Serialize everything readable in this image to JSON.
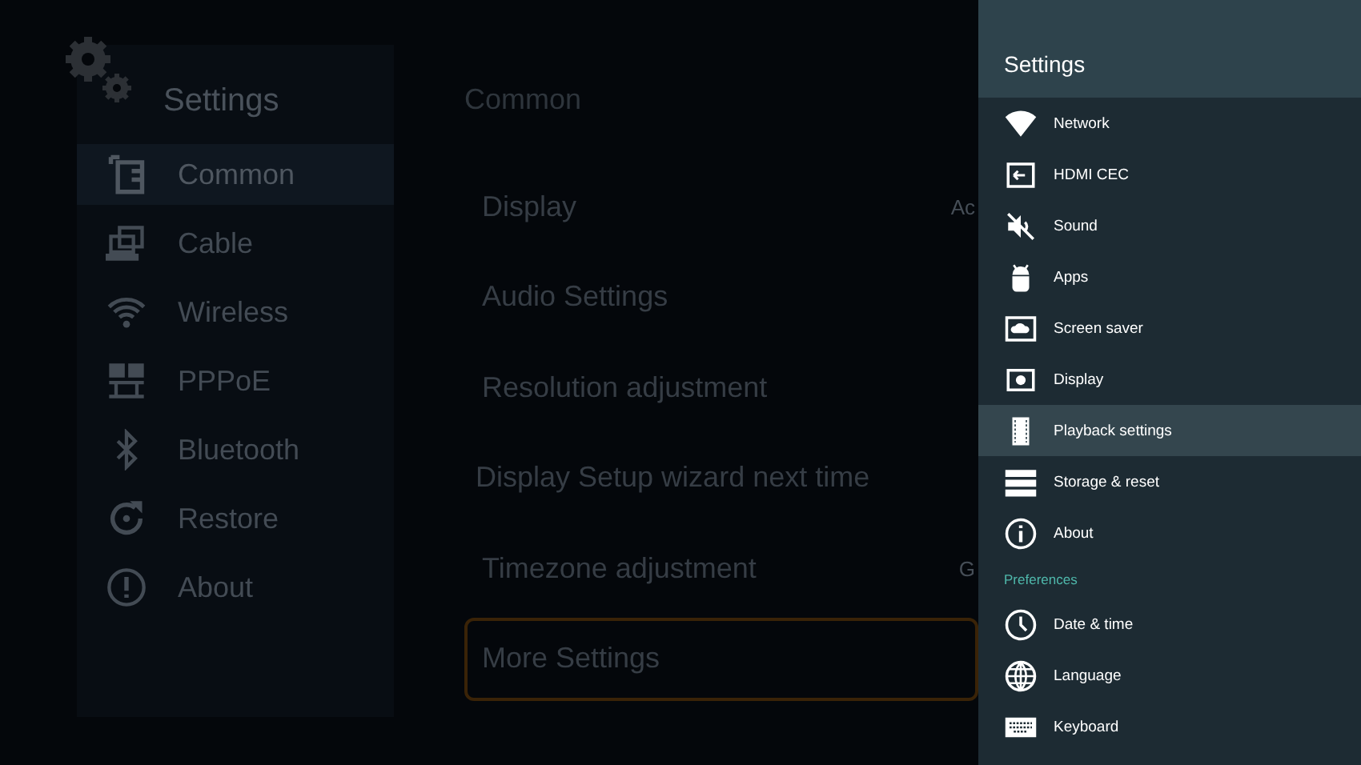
{
  "sidebar": {
    "title": "Settings",
    "items": [
      {
        "label": "Common",
        "selected": true
      },
      {
        "label": "Cable",
        "selected": false
      },
      {
        "label": "Wireless",
        "selected": false
      },
      {
        "label": "PPPoE",
        "selected": false
      },
      {
        "label": "Bluetooth",
        "selected": false
      },
      {
        "label": "Restore",
        "selected": false
      },
      {
        "label": "About",
        "selected": false
      }
    ]
  },
  "content": {
    "title": "Common",
    "items": [
      {
        "label": "Display",
        "value": "Ac",
        "selected": false
      },
      {
        "label": "Audio Settings",
        "selected": false
      },
      {
        "label": "Resolution adjustment",
        "selected": false
      },
      {
        "label": "Display Setup wizard next time",
        "selected": false
      },
      {
        "label": "Timezone adjustment",
        "value": "G",
        "selected": false
      },
      {
        "label": "More Settings",
        "selected": true
      }
    ]
  },
  "drawer": {
    "title": "Settings",
    "items": [
      {
        "kind": "item",
        "label": "Network",
        "selected": false
      },
      {
        "kind": "item",
        "label": "HDMI CEC",
        "selected": false
      },
      {
        "kind": "item",
        "label": "Sound",
        "selected": false
      },
      {
        "kind": "item",
        "label": "Apps",
        "selected": false
      },
      {
        "kind": "item",
        "label": "Screen saver",
        "selected": false
      },
      {
        "kind": "item",
        "label": "Display",
        "selected": false
      },
      {
        "kind": "item",
        "label": "Playback settings",
        "selected": true
      },
      {
        "kind": "item",
        "label": "Storage & reset",
        "selected": false
      },
      {
        "kind": "item",
        "label": "About",
        "selected": false
      },
      {
        "kind": "header",
        "label": "Preferences"
      },
      {
        "kind": "item",
        "label": "Date & time",
        "selected": false
      },
      {
        "kind": "item",
        "label": "Language",
        "selected": false
      },
      {
        "kind": "item",
        "label": "Keyboard",
        "selected": false
      }
    ]
  }
}
